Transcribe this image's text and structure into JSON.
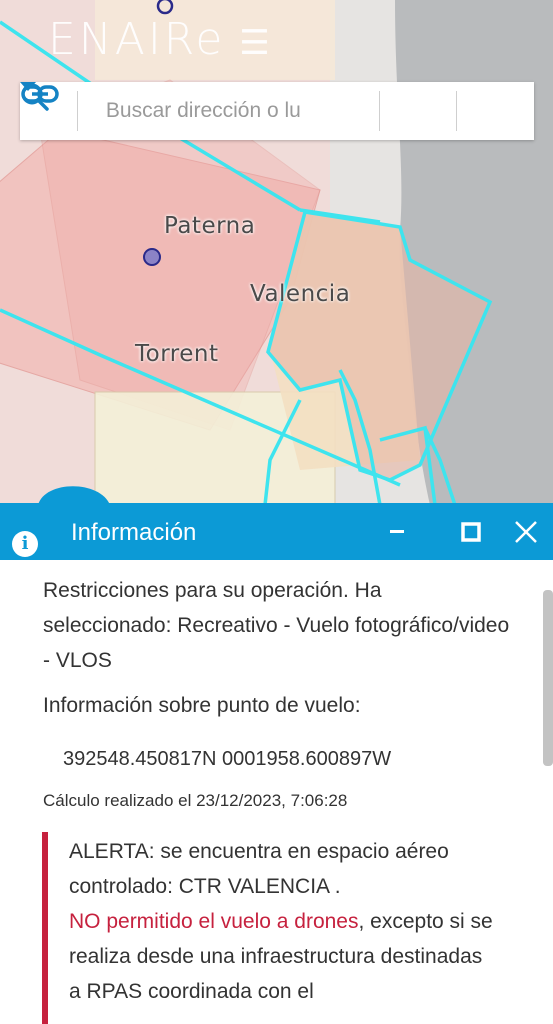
{
  "header": {
    "logo_text": "ENAIRe",
    "search_placeholder": "Buscar dirección o lu"
  },
  "map": {
    "labels": {
      "paterna": "Paterna",
      "valencia": "Valencia",
      "torrent": "Torrent"
    }
  },
  "panel": {
    "title": "Información",
    "restrictions_text": "Restricciones para su operación. Ha seleccionado: Recreativo - Vuelo fotográfico/video - VLOS",
    "flight_point_label": "Información sobre punto de vuelo:",
    "coordinates": "392548.450817N 0001958.600897W",
    "calculation": "Cálculo realizado el 23/12/2023, 7:06:28",
    "alert_intro": "ALERTA: se encuentra en espacio aéreo controlado: CTR VALENCIA .",
    "alert_red": "NO permitido el vuelo a drones",
    "alert_rest": ", excepto si se realiza desde una infraestructura destinadas a RPAS coordinada con el"
  },
  "colors": {
    "accent": "#0c9ad6",
    "alert": "#c6213e",
    "zone_cyan": "#3ee4ee"
  },
  "icons": [
    "dropdown-icon",
    "search-icon",
    "link-icon",
    "info-icon",
    "minimize-icon",
    "maximize-icon",
    "close-icon"
  ]
}
